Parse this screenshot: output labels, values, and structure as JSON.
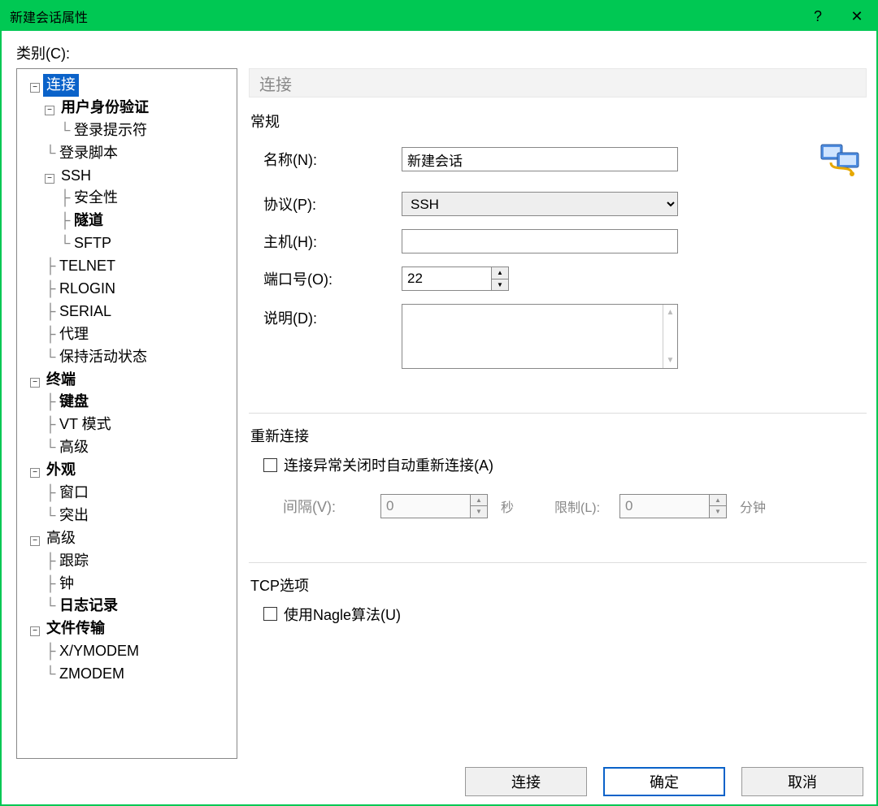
{
  "title": "新建会话属性",
  "category_label": "类别(C):",
  "tree": {
    "connection": "连接",
    "auth": "用户身份验证",
    "login_prompt": "登录提示符",
    "login_script": "登录脚本",
    "ssh": "SSH",
    "security": "安全性",
    "tunnel": "隧道",
    "sftp": "SFTP",
    "telnet": "TELNET",
    "rlogin": "RLOGIN",
    "serial": "SERIAL",
    "proxy": "代理",
    "keepalive": "保持活动状态",
    "terminal": "终端",
    "keyboard": "键盘",
    "vtmode": "VT 模式",
    "advanced_t": "高级",
    "appearance": "外观",
    "window": "窗口",
    "highlight": "突出",
    "advanced": "高级",
    "trace": "跟踪",
    "bell": "钟",
    "logging": "日志记录",
    "filetransfer": "文件传输",
    "xymodem": "X/YMODEM",
    "zmodem": "ZMODEM"
  },
  "panel_header": "连接",
  "general": {
    "title": "常规",
    "name_label": "名称(N):",
    "name_value": "新建会话",
    "protocol_label": "协议(P):",
    "protocol_value": "SSH",
    "host_label": "主机(H):",
    "host_value": "",
    "port_label": "端口号(O):",
    "port_value": "22",
    "desc_label": "说明(D):",
    "desc_value": ""
  },
  "reconnect": {
    "title": "重新连接",
    "auto_label": "连接异常关闭时自动重新连接(A)",
    "interval_label": "间隔(V):",
    "interval_value": "0",
    "interval_unit": "秒",
    "limit_label": "限制(L):",
    "limit_value": "0",
    "limit_unit": "分钟"
  },
  "tcp": {
    "title": "TCP选项",
    "nagle_label": "使用Nagle算法(U)"
  },
  "buttons": {
    "connect": "连接",
    "ok": "确定",
    "cancel": "取消"
  }
}
